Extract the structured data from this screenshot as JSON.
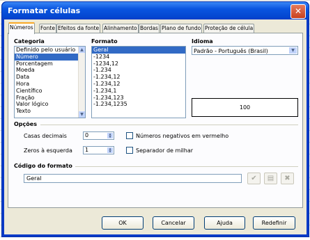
{
  "window": {
    "title": "Formatar células",
    "close_glyph": "✕"
  },
  "tabs": [
    {
      "label": "Números"
    },
    {
      "label": "Fonte"
    },
    {
      "label": "Efeitos da fonte"
    },
    {
      "label": "Alinhamento"
    },
    {
      "label": "Bordas"
    },
    {
      "label": "Plano de fundo"
    },
    {
      "label": "Proteção de célula"
    }
  ],
  "category": {
    "heading": "Categoria",
    "items": [
      "Definido pelo usuário",
      "Número",
      "Porcentagem",
      "Moeda",
      "Data",
      "Hora",
      "Científico",
      "Fração",
      "Valor lógico",
      "Texto"
    ],
    "selected": "Número"
  },
  "format": {
    "heading": "Formato",
    "items": [
      "Geral",
      "-1234",
      "-1234,12",
      "-1.234",
      "-1.234,12",
      "-1.234,12",
      "-1.234,1",
      "-1.234,123",
      "-1.234,1235"
    ],
    "selected": "Geral"
  },
  "language": {
    "heading": "Idioma",
    "value": "Padrão - Português (Brasil)"
  },
  "preview": {
    "value": "100"
  },
  "options": {
    "heading": "Opções",
    "decimal_label": "Casas decimais",
    "decimal_value": "0",
    "leading_zeros_label": "Zeros à esquerda",
    "leading_zeros_value": "1",
    "negative_red_label": "Números negativos em vermelho",
    "negative_red_checked": false,
    "thousands_sep_label": "Separador de milhar",
    "thousands_sep_checked": false
  },
  "format_code": {
    "heading": "Código do formato",
    "value": "Geral"
  },
  "buttons": {
    "ok": "OK",
    "cancel": "Cancelar",
    "help": "Ajuda",
    "reset": "Redefinir"
  },
  "icons": {
    "accept": "check-icon",
    "comment": "edit-comment-icon",
    "delete": "delete-icon"
  }
}
